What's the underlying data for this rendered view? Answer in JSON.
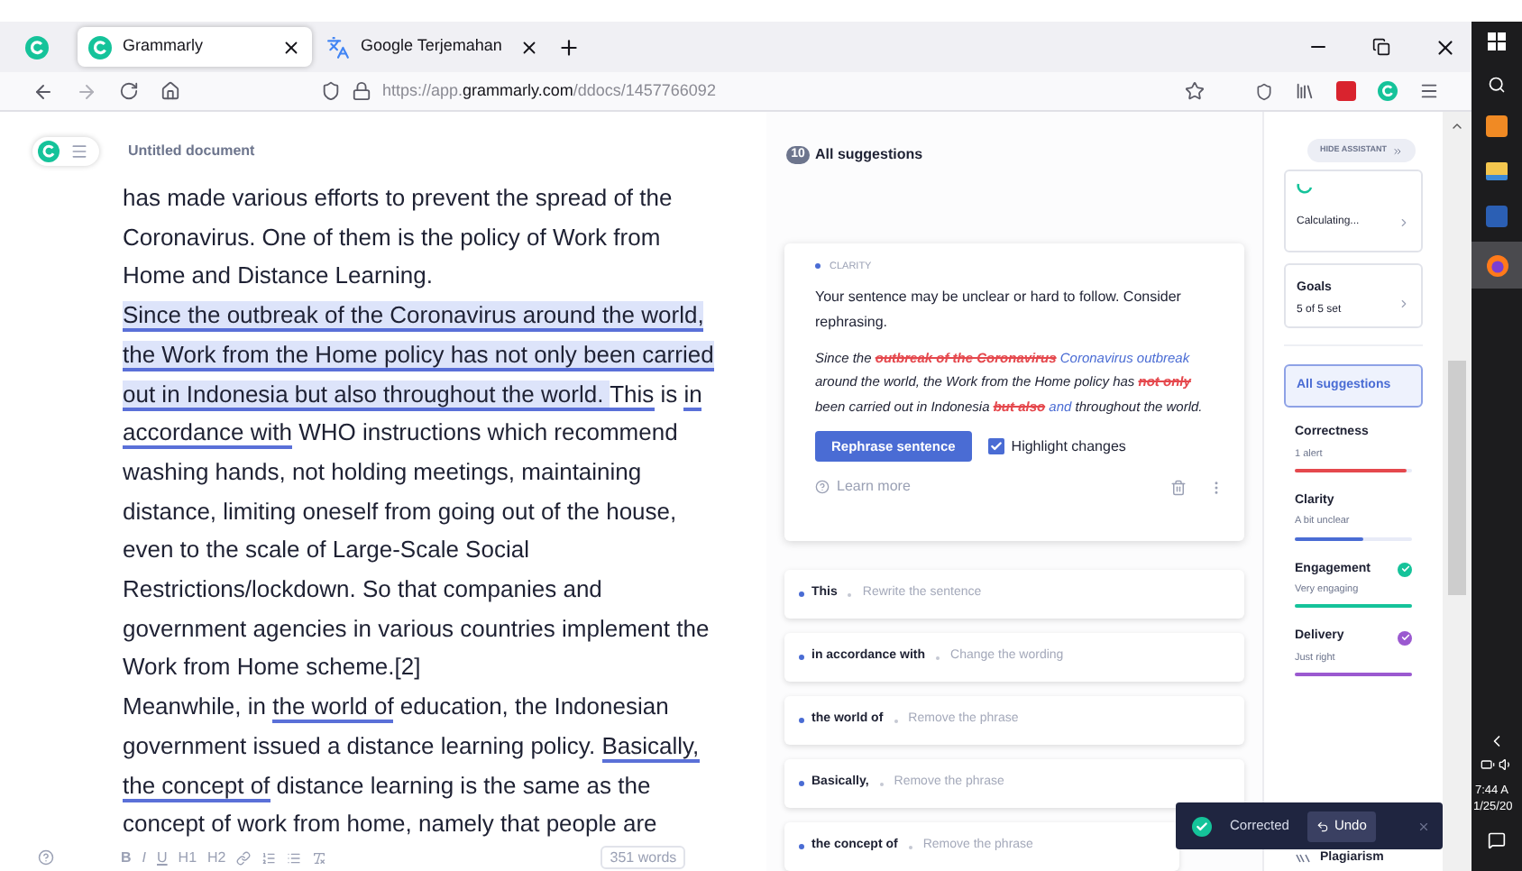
{
  "browser": {
    "tabs": [
      {
        "title": "Grammarly",
        "kind": "grammarly",
        "selected": true
      },
      {
        "title": "Google Terjemahan",
        "kind": "translate",
        "selected": false
      }
    ],
    "url": {
      "prefix": "https://app.",
      "domain": "grammarly.com",
      "path": "/ddocs/1457766092"
    }
  },
  "editor": {
    "title": "Untitled document",
    "lines": [
      [
        {
          "t": "has made various efforts to prevent the spread of the",
          "kind": "plain"
        }
      ],
      [
        {
          "t": "Coronavirus. One of them is the policy of Work from",
          "kind": "plain"
        }
      ],
      [
        {
          "t": "Home and Distance Learning.",
          "kind": "plain"
        }
      ],
      [
        {
          "t": "Since the outbreak of the Coronavirus around the world,",
          "kind": "highlight"
        }
      ],
      [
        {
          "t": "the Work from the Home policy has not only been carried",
          "kind": "highlight"
        }
      ],
      [
        {
          "t": "out in Indonesia but also throughout the world. ",
          "kind": "highlight"
        },
        {
          "t": "This",
          "kind": "underline"
        },
        {
          "t": " is ",
          "kind": "plain"
        },
        {
          "t": "in",
          "kind": "underline"
        }
      ],
      [
        {
          "t": "accordance with",
          "kind": "underline"
        },
        {
          "t": " WHO instructions which recommend",
          "kind": "plain"
        }
      ],
      [
        {
          "t": "washing hands, not holding meetings, maintaining",
          "kind": "plain"
        }
      ],
      [
        {
          "t": "distance, limiting oneself from going out of the house,",
          "kind": "plain"
        }
      ],
      [
        {
          "t": "even to the scale of Large-Scale Social",
          "kind": "plain"
        }
      ],
      [
        {
          "t": "Restrictions/lockdown. So that companies and",
          "kind": "plain"
        }
      ],
      [
        {
          "t": "government agencies in various countries implement the",
          "kind": "plain"
        }
      ],
      [
        {
          "t": "Work from Home scheme.[2]",
          "kind": "plain"
        }
      ],
      [
        {
          "t": "Meanwhile, in ",
          "kind": "plain"
        },
        {
          "t": "the world of",
          "kind": "underline"
        },
        {
          "t": " education, the Indonesian",
          "kind": "plain"
        }
      ],
      [
        {
          "t": "government issued a distance learning policy. ",
          "kind": "plain"
        },
        {
          "t": "Basically,",
          "kind": "underline"
        }
      ],
      [
        {
          "t": "the concept of",
          "kind": "underline"
        },
        {
          "t": " distance learning is the same as the",
          "kind": "plain"
        }
      ],
      [
        {
          "t": "concept of work from home, namely that people are",
          "kind": "plain"
        }
      ]
    ],
    "format_buttons": [
      "B",
      "I",
      "U",
      "H1",
      "H2"
    ],
    "word_count": "351 words"
  },
  "suggestions": {
    "count": "10",
    "title": "All suggestions",
    "card": {
      "category": "CLARITY",
      "message": "Your sentence may be unclear or hard to follow. Consider rephrasing.",
      "preview": [
        {
          "t": "Since the ",
          "kind": "plain"
        },
        {
          "t": "outbreak of the Coronavirus",
          "kind": "deleted"
        },
        {
          "t": " Coronavirus outbreak",
          "kind": "inserted"
        },
        {
          "t": " around the world, the Work from the Home policy has ",
          "kind": "plain"
        },
        {
          "t": "not only",
          "kind": "deleted"
        },
        {
          "t": " been carried out in Indonesia ",
          "kind": "plain"
        },
        {
          "t": "but also",
          "kind": "deleted"
        },
        {
          "t": " and",
          "kind": "inserted"
        },
        {
          "t": " throughout the world.",
          "kind": "plain"
        }
      ],
      "button": "Rephrase sentence",
      "highlight_changes": {
        "label": "Highlight changes",
        "checked": true
      },
      "learn_more": "Learn more"
    },
    "items": [
      {
        "phrase": "This",
        "action": "Rewrite the sentence"
      },
      {
        "phrase": "in accordance with",
        "action": "Change the wording"
      },
      {
        "phrase": "the world of",
        "action": "Remove the phrase"
      },
      {
        "phrase": "Basically,",
        "action": "Remove the phrase"
      },
      {
        "phrase": "the concept of",
        "action": "Remove the phrase"
      }
    ]
  },
  "assistant": {
    "hide_button": "HIDE ASSISTANT",
    "score": {
      "label": "Calculating..."
    },
    "goals": {
      "title": "Goals",
      "value": "5 of 5 set"
    },
    "all_suggestions": {
      "label": "All suggestions",
      "selected": true
    },
    "categories": [
      {
        "name": "Correctness",
        "status": "1 alert",
        "level": 0.95,
        "color": "#e5484d",
        "done": false
      },
      {
        "name": "Clarity",
        "status": "A bit unclear",
        "level": 0.58,
        "color": "#4a6cd4",
        "done": false
      },
      {
        "name": "Engagement",
        "status": "Very engaging",
        "level": 1,
        "color": "#15c39a",
        "done": true
      },
      {
        "name": "Delivery",
        "status": "Just right",
        "level": 1,
        "color": "#9b59d0",
        "done": true
      }
    ],
    "plagiarism": "Plagiarism"
  },
  "toast": {
    "message": "Corrected",
    "undo": "Undo"
  },
  "taskbar": {
    "time": "7:44 A",
    "date": "1/25/20"
  }
}
